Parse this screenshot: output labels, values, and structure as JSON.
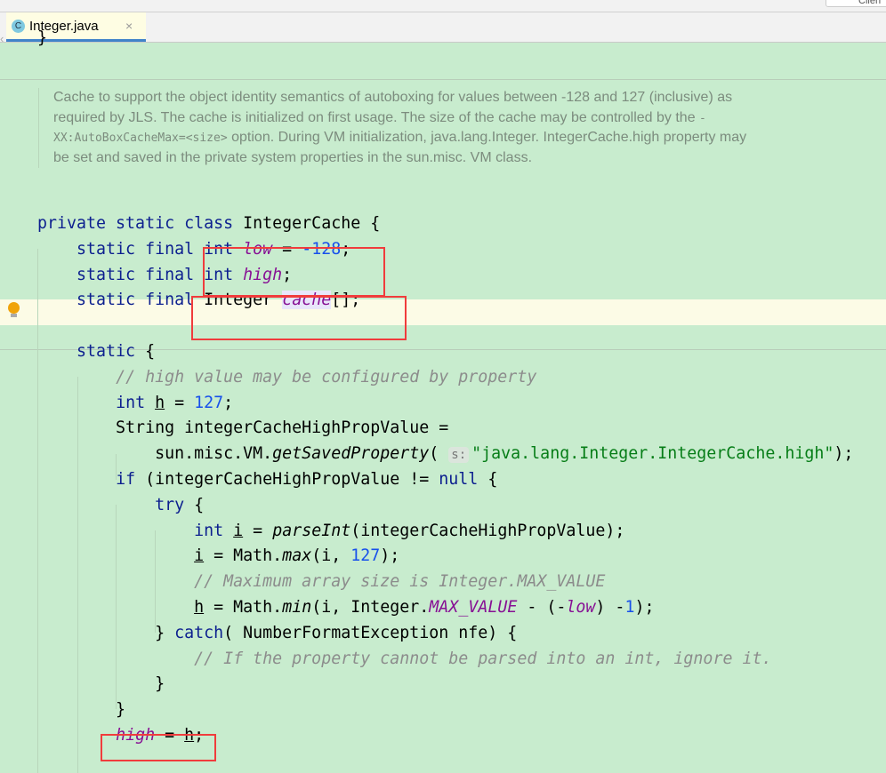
{
  "tab": {
    "label": "Integer.java",
    "icon": "java-class-icon",
    "icon_letter": "C",
    "close": "×"
  },
  "top_button": "Clien",
  "prev_brace": "}",
  "doc_comment": {
    "p1": "Cache to support the object identity semantics of autoboxing for values between -128 and 127 (inclusive) as required by JLS. The cache is initialized on first usage. The size of the cache may be controlled by the ",
    "code": "-XX:AutoBoxCacheMax=<size>",
    "p2": " option. During VM initialization, java.lang.Integer. IntegerCache.high property may be set and saved in the private system properties in the sun.misc. VM class."
  },
  "code_lines": [
    [
      [
        "kw",
        "private static class "
      ],
      [
        "",
        "IntegerCache {"
      ]
    ],
    [
      [
        "",
        "    "
      ],
      [
        "kw",
        "static final int "
      ],
      [
        "fld",
        "low"
      ],
      [
        "",
        " = "
      ],
      [
        "num",
        "-128"
      ],
      [
        "",
        ";"
      ]
    ],
    [
      [
        "",
        "    "
      ],
      [
        "kw",
        "static final int "
      ],
      [
        "fld",
        "high"
      ],
      [
        "",
        ";"
      ]
    ],
    [
      [
        "",
        "    "
      ],
      [
        "kw",
        "static final "
      ],
      [
        "",
        "Integer "
      ],
      [
        "fld cur",
        "cache"
      ],
      [
        "",
        "[];"
      ]
    ],
    [],
    [
      [
        "",
        "    "
      ],
      [
        "kw",
        "static"
      ],
      [
        "",
        " {"
      ]
    ],
    [
      [
        "",
        "        "
      ],
      [
        "cmt",
        "// high value may be configured by property"
      ]
    ],
    [
      [
        "",
        "        "
      ],
      [
        "kw",
        "int "
      ],
      [
        "ul",
        "h"
      ],
      [
        "",
        " = "
      ],
      [
        "num",
        "127"
      ],
      [
        "",
        ";"
      ]
    ],
    [
      [
        "",
        "        String integerCacheHighPropValue ="
      ]
    ],
    [
      [
        "",
        "            sun.misc.VM."
      ],
      [
        "mth",
        "getSavedProperty"
      ],
      [
        "",
        "( "
      ],
      [
        "hint",
        "s:"
      ],
      [
        "str",
        "\"java.lang.Integer.IntegerCache.high\""
      ],
      [
        "",
        ");"
      ]
    ],
    [
      [
        "",
        "        "
      ],
      [
        "kw",
        "if"
      ],
      [
        "",
        " (integerCacheHighPropValue != "
      ],
      [
        "kw",
        "null"
      ],
      [
        "",
        " {"
      ]
    ],
    [
      [
        "",
        "            "
      ],
      [
        "kw",
        "try"
      ],
      [
        "",
        " {"
      ]
    ],
    [
      [
        "",
        "                "
      ],
      [
        "kw",
        "int "
      ],
      [
        "ul",
        "i"
      ],
      [
        "",
        " = "
      ],
      [
        "mth",
        "parseInt"
      ],
      [
        "",
        "(integerCacheHighPropValue);"
      ]
    ],
    [
      [
        "",
        "                "
      ],
      [
        "ul",
        "i"
      ],
      [
        "",
        " = Math."
      ],
      [
        "mth",
        "max"
      ],
      [
        "",
        "(i, "
      ],
      [
        "num",
        "127"
      ],
      [
        "",
        ");"
      ]
    ],
    [
      [
        "",
        "                "
      ],
      [
        "cmt",
        "// Maximum array size is Integer.MAX_VALUE"
      ]
    ],
    [
      [
        "",
        "                "
      ],
      [
        "ul",
        "h"
      ],
      [
        "",
        " = Math."
      ],
      [
        "mth",
        "min"
      ],
      [
        "",
        "(i, Integer."
      ],
      [
        "cst",
        "MAX_VALUE"
      ],
      [
        "",
        " - (-"
      ],
      [
        "fld",
        "low"
      ],
      [
        "",
        ") -"
      ],
      [
        "num",
        "1"
      ],
      [
        "",
        ");"
      ]
    ],
    [
      [
        "",
        "            } "
      ],
      [
        "kw",
        "catch"
      ],
      [
        "",
        "( NumberFormatException nfe) {"
      ]
    ],
    [
      [
        "",
        "                "
      ],
      [
        "cmt",
        "// If the property cannot be parsed into an int, ignore it."
      ]
    ],
    [
      [
        "",
        "            }"
      ]
    ],
    [
      [
        "",
        "        }"
      ]
    ],
    [
      [
        "",
        "        "
      ],
      [
        "fld",
        "high"
      ],
      [
        "",
        " = "
      ],
      [
        "ul",
        "h"
      ],
      [
        "",
        ";"
      ]
    ]
  ]
}
